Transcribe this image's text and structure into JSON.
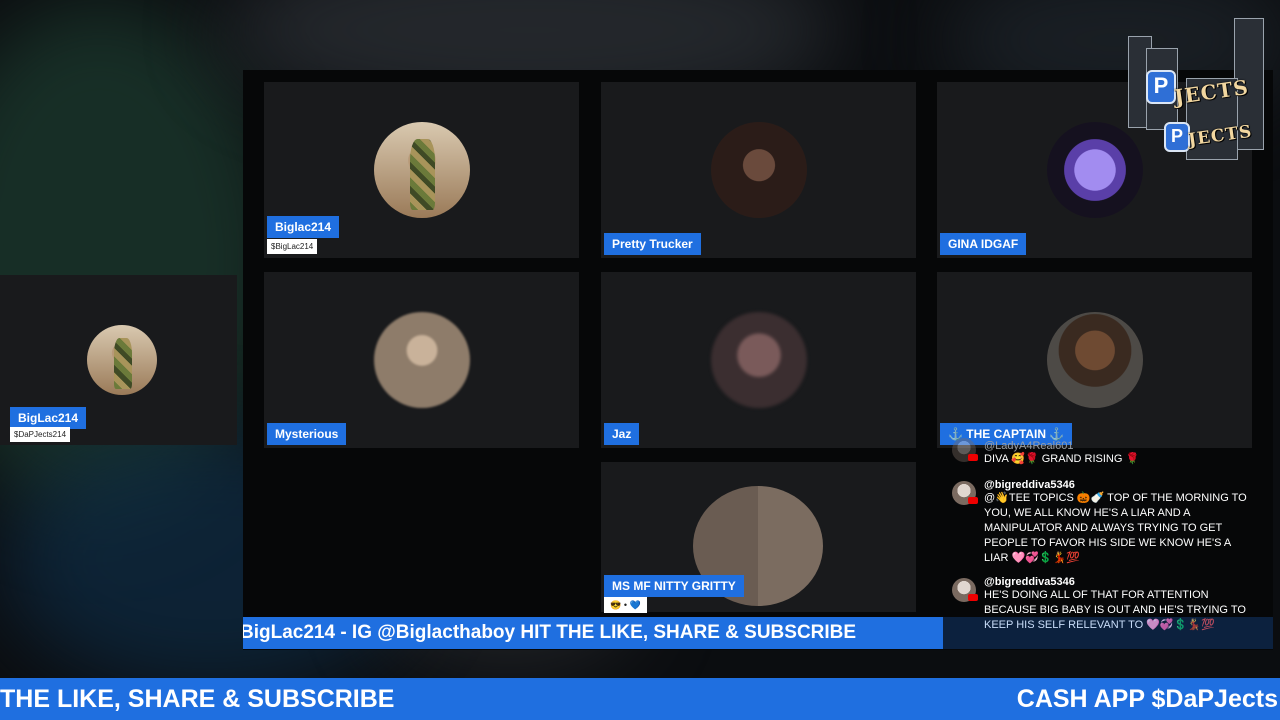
{
  "participants": [
    {
      "name": "Biglac214",
      "handle": "$BigLac214"
    },
    {
      "name": "Pretty Trucker"
    },
    {
      "name": "GINA IDGAF"
    },
    {
      "name": "Mysterious"
    },
    {
      "name": "Jaz"
    },
    {
      "name": "⚓ THE CAPTAIN ⚓"
    },
    {
      "name": "MS MF NITTY GRITTY",
      "reaction": "😎 • 💙"
    }
  ],
  "host_preview": {
    "name": "BigLac214",
    "handle": "$DaPJects214"
  },
  "logo": {
    "letter": "P",
    "word": "JECTS"
  },
  "chat": [
    {
      "author": "@LadyA4Real601",
      "text": "DIVA 🥰🌹 GRAND RISING 🌹"
    },
    {
      "author": "@bigreddiva5346",
      "text": "@👋TEE TOPICS 🎃🍼 TOP OF THE MORNING TO YOU, WE ALL KNOW HE'S A LIAR AND A MANIPULATOR AND ALWAYS TRYING TO GET PEOPLE TO FAVOR HIS SIDE WE KNOW HE'S A LIAR 🩷💞💲💃💯"
    },
    {
      "author": "@bigreddiva5346",
      "text": "HE'S DOING ALL OF THAT FOR ATTENTION BECAUSE BIG BABY IS OUT AND HE'S TRYING TO KEEP HIS SELF RELEVANT TO 🩷💞💲💃💯"
    }
  ],
  "ticker": "BigLac214 - IG @Biglacthaboy HIT THE LIKE, SHARE & SUBSCRIBE",
  "bottom_bar": {
    "left": "THE LIKE, SHARE & SUBSCRIBE",
    "right": "CASH APP $DaPJects"
  }
}
